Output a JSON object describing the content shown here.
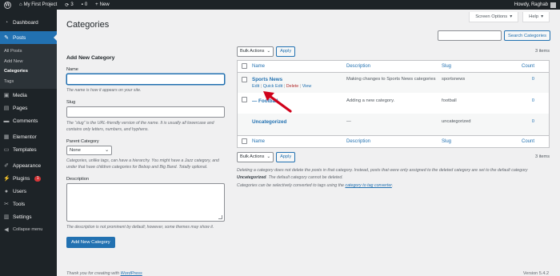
{
  "adminbar": {
    "site_name": "My First Project",
    "updates_count": "3",
    "comments_count": "0",
    "new_label": "New",
    "howdy": "Howdy, Raghab"
  },
  "sidebar": {
    "items": [
      {
        "label": "Dashboard",
        "icon": "dashboard-icon"
      },
      {
        "label": "Posts",
        "icon": "pin-icon"
      },
      {
        "label": "Media",
        "icon": "media-icon"
      },
      {
        "label": "Pages",
        "icon": "pages-icon"
      },
      {
        "label": "Comments",
        "icon": "comment-icon"
      },
      {
        "label": "Elementor",
        "icon": "elementor-icon"
      },
      {
        "label": "Templates",
        "icon": "folder-icon"
      },
      {
        "label": "Appearance",
        "icon": "brush-icon"
      },
      {
        "label": "Plugins",
        "icon": "plug-icon",
        "badge": "1"
      },
      {
        "label": "Users",
        "icon": "user-icon"
      },
      {
        "label": "Tools",
        "icon": "wrench-icon"
      },
      {
        "label": "Settings",
        "icon": "settings-icon"
      },
      {
        "label": "Collapse menu",
        "icon": "collapse-icon"
      }
    ],
    "posts_submenu": [
      "All Posts",
      "Add New",
      "Categories",
      "Tags"
    ]
  },
  "header": {
    "title": "Categories",
    "screen_options": "Screen Options",
    "help": "Help"
  },
  "search": {
    "button": "Search Categories"
  },
  "form": {
    "heading": "Add New Category",
    "name_label": "Name",
    "name_help": "The name is how it appears on your site.",
    "slug_label": "Slug",
    "slug_help": "The “slug” is the URL-friendly version of the name. It is usually all lowercase and contains only letters, numbers, and hyphens.",
    "parent_label": "Parent Category",
    "parent_value": "None",
    "parent_help": "Categories, unlike tags, can have a hierarchy. You might have a Jazz category, and under that have children categories for Bebop and Big Band. Totally optional.",
    "desc_label": "Description",
    "desc_help": "The description is not prominent by default; however, some themes may show it.",
    "submit": "Add New Category"
  },
  "list": {
    "bulk_actions": "Bulk Actions",
    "apply": "Apply",
    "items_count": "3 items",
    "columns": {
      "name": "Name",
      "description": "Description",
      "slug": "Slug",
      "count": "Count"
    },
    "rows": [
      {
        "name": "Sports News",
        "description": "Making changes to Sports News categories",
        "slug": "sportsnews",
        "count": "0",
        "actions": {
          "edit": "Edit",
          "quick_edit": "Quick Edit",
          "delete": "Delete",
          "view": "View"
        }
      },
      {
        "name": "— Football",
        "description": "Adding a new category.",
        "slug": "football",
        "count": "0"
      },
      {
        "name": "Uncategorized",
        "description": "—",
        "slug": "uncategorized",
        "count": "0"
      }
    ],
    "note1_pre": "Deleting a category does not delete the posts in that category. Instead, posts that were only assigned to the deleted category are set to the default category ",
    "note1_bold": "Uncategorized",
    "note1_post": ". The default category cannot be deleted.",
    "note2_pre": "Categories can be selectively converted to tags using the ",
    "note2_link": "category to tag converter",
    "note2_post": "."
  },
  "footer": {
    "thanks_pre": "Thank you for creating with ",
    "thanks_link": "WordPress",
    "version": "Version 5.4.2"
  },
  "colors": {
    "accent": "#2271b1",
    "sidebar": "#1d2327",
    "annotation": "#d0021b"
  }
}
